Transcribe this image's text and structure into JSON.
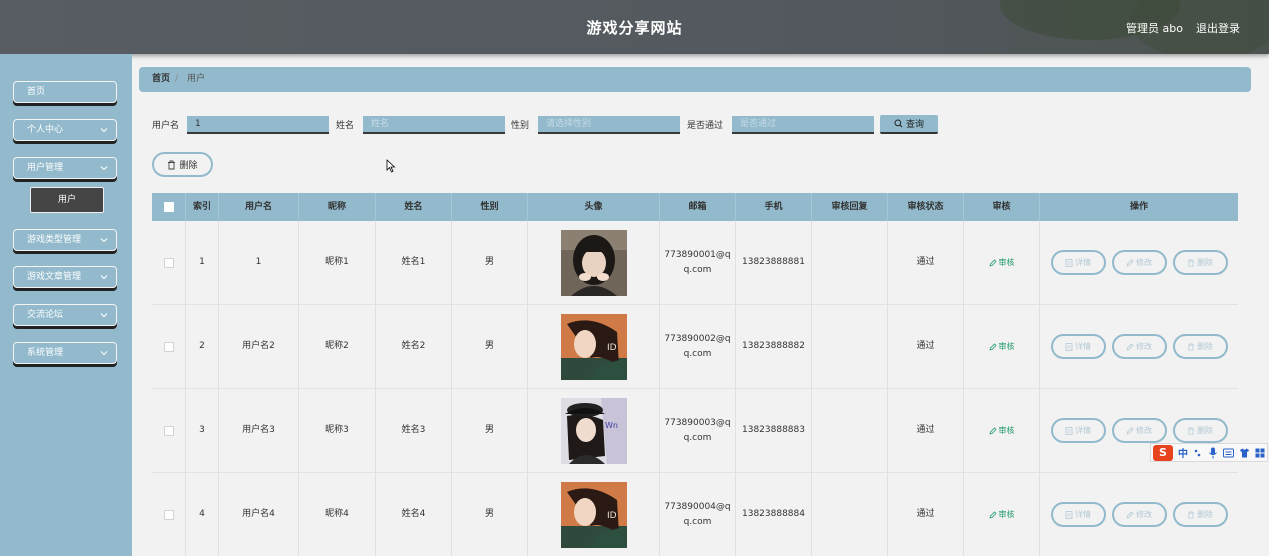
{
  "header": {
    "title": "游戏分享网站",
    "admin_text": "管理员 abo",
    "logout": "退出登录"
  },
  "sidebar": {
    "items": [
      {
        "label": "首页",
        "icon": "none"
      },
      {
        "label": "个人中心",
        "icon": "chevron-down"
      },
      {
        "label": "用户管理",
        "icon": "chevron-down"
      },
      {
        "label": "游戏类型管理",
        "icon": "chevron-down"
      },
      {
        "label": "游戏文章管理",
        "icon": "chevron-down"
      },
      {
        "label": "交流论坛",
        "icon": "chevron-down"
      },
      {
        "label": "系统管理",
        "icon": "chevron-down"
      }
    ],
    "active_sub": "用户"
  },
  "breadcrumb": {
    "home": "首页",
    "sep": "/",
    "current": "用户"
  },
  "search": {
    "username_label": "用户名",
    "username_value": "1",
    "name_label": "姓名",
    "name_placeholder": "姓名",
    "gender_label": "性别",
    "gender_placeholder": "请选择性别",
    "passed_label": "是否通过",
    "passed_placeholder": "是否通过",
    "query_button": "查询"
  },
  "actions": {
    "delete_button": "删除"
  },
  "table": {
    "columns": [
      "",
      "索引",
      "用户名",
      "昵称",
      "姓名",
      "性别",
      "头像",
      "邮箱",
      "手机",
      "审核回复",
      "审核状态",
      "审核",
      "操作"
    ],
    "rows": [
      {
        "index": "1",
        "username": "1",
        "nickname": "昵称1",
        "name": "姓名1",
        "gender": "男",
        "email": "773890001@qq.com",
        "phone": "13823888881",
        "reply": "",
        "status": "通过",
        "audit": "审核"
      },
      {
        "index": "2",
        "username": "用户名2",
        "nickname": "昵称2",
        "name": "姓名2",
        "gender": "男",
        "email": "773890002@qq.com",
        "phone": "13823888882",
        "reply": "",
        "status": "通过",
        "audit": "审核"
      },
      {
        "index": "3",
        "username": "用户名3",
        "nickname": "昵称3",
        "name": "姓名3",
        "gender": "男",
        "email": "773890003@qq.com",
        "phone": "13823888883",
        "reply": "",
        "status": "通过",
        "audit": "审核"
      },
      {
        "index": "4",
        "username": "用户名4",
        "nickname": "昵称4",
        "name": "姓名4",
        "gender": "男",
        "email": "773890004@qq.com",
        "phone": "13823888884",
        "reply": "",
        "status": "通过",
        "audit": "审核"
      }
    ],
    "op_labels": {
      "detail": "详情",
      "edit": "修改",
      "delete": "删除"
    }
  },
  "ime": {
    "logo": "S",
    "mode": "中"
  },
  "colors": {
    "accent": "#92bacc",
    "header": "#575d62",
    "audit": "#1f9a6a"
  }
}
